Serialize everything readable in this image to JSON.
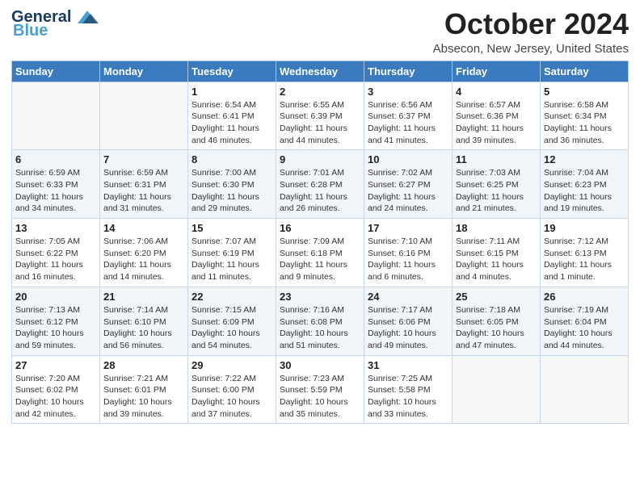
{
  "logo": {
    "line1": "General",
    "line2": "Blue"
  },
  "title": "October 2024",
  "location": "Absecon, New Jersey, United States",
  "days_of_week": [
    "Sunday",
    "Monday",
    "Tuesday",
    "Wednesday",
    "Thursday",
    "Friday",
    "Saturday"
  ],
  "weeks": [
    [
      {
        "day": "",
        "info": ""
      },
      {
        "day": "",
        "info": ""
      },
      {
        "day": "1",
        "info": "Sunrise: 6:54 AM\nSunset: 6:41 PM\nDaylight: 11 hours and 46 minutes."
      },
      {
        "day": "2",
        "info": "Sunrise: 6:55 AM\nSunset: 6:39 PM\nDaylight: 11 hours and 44 minutes."
      },
      {
        "day": "3",
        "info": "Sunrise: 6:56 AM\nSunset: 6:37 PM\nDaylight: 11 hours and 41 minutes."
      },
      {
        "day": "4",
        "info": "Sunrise: 6:57 AM\nSunset: 6:36 PM\nDaylight: 11 hours and 39 minutes."
      },
      {
        "day": "5",
        "info": "Sunrise: 6:58 AM\nSunset: 6:34 PM\nDaylight: 11 hours and 36 minutes."
      }
    ],
    [
      {
        "day": "6",
        "info": "Sunrise: 6:59 AM\nSunset: 6:33 PM\nDaylight: 11 hours and 34 minutes."
      },
      {
        "day": "7",
        "info": "Sunrise: 6:59 AM\nSunset: 6:31 PM\nDaylight: 11 hours and 31 minutes."
      },
      {
        "day": "8",
        "info": "Sunrise: 7:00 AM\nSunset: 6:30 PM\nDaylight: 11 hours and 29 minutes."
      },
      {
        "day": "9",
        "info": "Sunrise: 7:01 AM\nSunset: 6:28 PM\nDaylight: 11 hours and 26 minutes."
      },
      {
        "day": "10",
        "info": "Sunrise: 7:02 AM\nSunset: 6:27 PM\nDaylight: 11 hours and 24 minutes."
      },
      {
        "day": "11",
        "info": "Sunrise: 7:03 AM\nSunset: 6:25 PM\nDaylight: 11 hours and 21 minutes."
      },
      {
        "day": "12",
        "info": "Sunrise: 7:04 AM\nSunset: 6:23 PM\nDaylight: 11 hours and 19 minutes."
      }
    ],
    [
      {
        "day": "13",
        "info": "Sunrise: 7:05 AM\nSunset: 6:22 PM\nDaylight: 11 hours and 16 minutes."
      },
      {
        "day": "14",
        "info": "Sunrise: 7:06 AM\nSunset: 6:20 PM\nDaylight: 11 hours and 14 minutes."
      },
      {
        "day": "15",
        "info": "Sunrise: 7:07 AM\nSunset: 6:19 PM\nDaylight: 11 hours and 11 minutes."
      },
      {
        "day": "16",
        "info": "Sunrise: 7:09 AM\nSunset: 6:18 PM\nDaylight: 11 hours and 9 minutes."
      },
      {
        "day": "17",
        "info": "Sunrise: 7:10 AM\nSunset: 6:16 PM\nDaylight: 11 hours and 6 minutes."
      },
      {
        "day": "18",
        "info": "Sunrise: 7:11 AM\nSunset: 6:15 PM\nDaylight: 11 hours and 4 minutes."
      },
      {
        "day": "19",
        "info": "Sunrise: 7:12 AM\nSunset: 6:13 PM\nDaylight: 11 hours and 1 minute."
      }
    ],
    [
      {
        "day": "20",
        "info": "Sunrise: 7:13 AM\nSunset: 6:12 PM\nDaylight: 10 hours and 59 minutes."
      },
      {
        "day": "21",
        "info": "Sunrise: 7:14 AM\nSunset: 6:10 PM\nDaylight: 10 hours and 56 minutes."
      },
      {
        "day": "22",
        "info": "Sunrise: 7:15 AM\nSunset: 6:09 PM\nDaylight: 10 hours and 54 minutes."
      },
      {
        "day": "23",
        "info": "Sunrise: 7:16 AM\nSunset: 6:08 PM\nDaylight: 10 hours and 51 minutes."
      },
      {
        "day": "24",
        "info": "Sunrise: 7:17 AM\nSunset: 6:06 PM\nDaylight: 10 hours and 49 minutes."
      },
      {
        "day": "25",
        "info": "Sunrise: 7:18 AM\nSunset: 6:05 PM\nDaylight: 10 hours and 47 minutes."
      },
      {
        "day": "26",
        "info": "Sunrise: 7:19 AM\nSunset: 6:04 PM\nDaylight: 10 hours and 44 minutes."
      }
    ],
    [
      {
        "day": "27",
        "info": "Sunrise: 7:20 AM\nSunset: 6:02 PM\nDaylight: 10 hours and 42 minutes."
      },
      {
        "day": "28",
        "info": "Sunrise: 7:21 AM\nSunset: 6:01 PM\nDaylight: 10 hours and 39 minutes."
      },
      {
        "day": "29",
        "info": "Sunrise: 7:22 AM\nSunset: 6:00 PM\nDaylight: 10 hours and 37 minutes."
      },
      {
        "day": "30",
        "info": "Sunrise: 7:23 AM\nSunset: 5:59 PM\nDaylight: 10 hours and 35 minutes."
      },
      {
        "day": "31",
        "info": "Sunrise: 7:25 AM\nSunset: 5:58 PM\nDaylight: 10 hours and 33 minutes."
      },
      {
        "day": "",
        "info": ""
      },
      {
        "day": "",
        "info": ""
      }
    ]
  ]
}
